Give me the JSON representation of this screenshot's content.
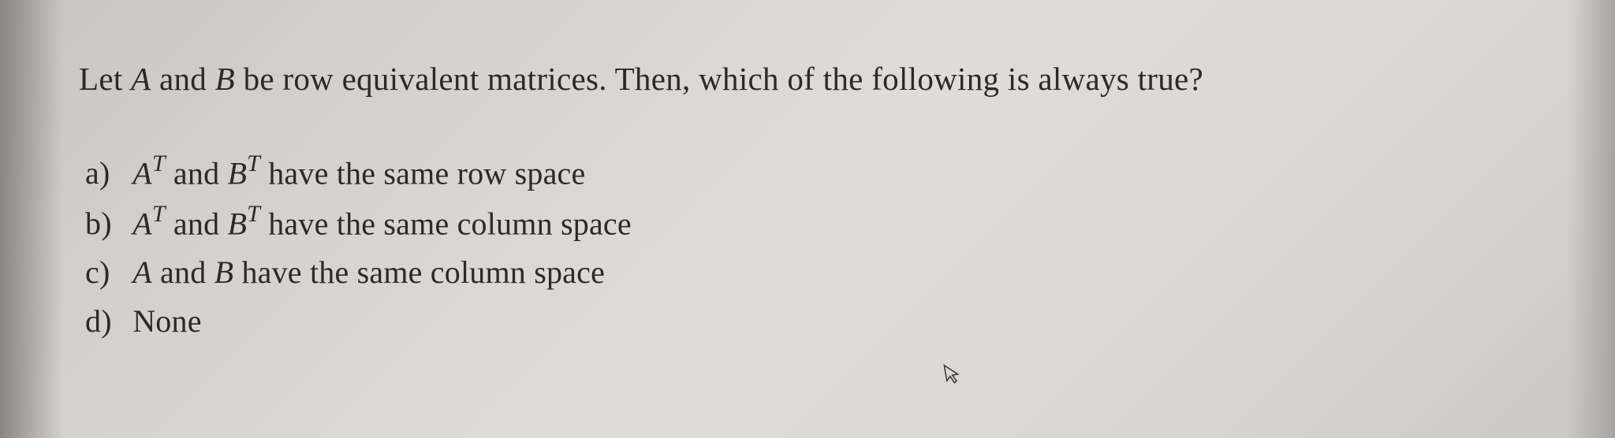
{
  "question": {
    "prompt_pre": "Let ",
    "var_A": "A",
    "prompt_mid1": " and ",
    "var_B": "B",
    "prompt_post": " be row equivalent matrices. Then, which of the following is always true?"
  },
  "options": {
    "a": {
      "label": "a)",
      "pre": "",
      "m1_base": "A",
      "m1_sup": "T",
      "mid1": " and ",
      "m2_base": "B",
      "m2_sup": "T",
      "post": " have the same row space"
    },
    "b": {
      "label": "b)",
      "pre": "",
      "m1_base": "A",
      "m1_sup": "T",
      "mid1": " and ",
      "m2_base": "B",
      "m2_sup": "T",
      "post": " have the same column space"
    },
    "c": {
      "label": "c)",
      "pre": "",
      "m1_base": "A",
      "m1_sup": "",
      "mid1": " and ",
      "m2_base": "B",
      "m2_sup": "",
      "post": " have the same column space"
    },
    "d": {
      "label": "d)",
      "text": "None"
    }
  },
  "cursor_glyph": "↖"
}
